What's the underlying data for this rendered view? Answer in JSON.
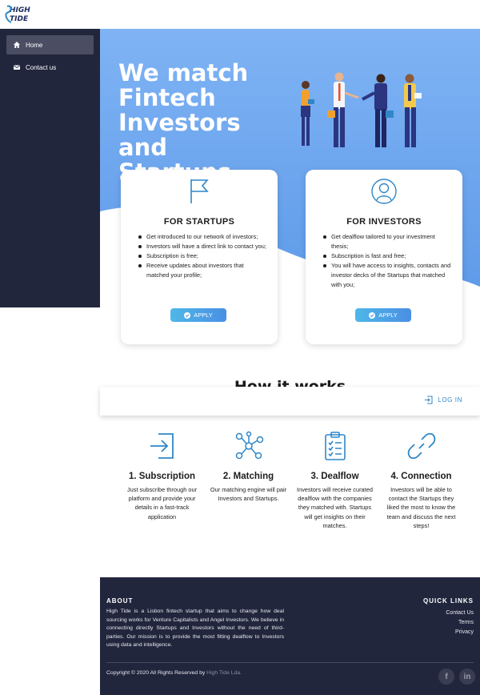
{
  "brand": {
    "logo_line1": "HIGH",
    "logo_line2": "TIDE"
  },
  "sidebar": {
    "items": [
      {
        "label": "Home",
        "icon": "home-icon",
        "active": true
      },
      {
        "label": "Contact us",
        "icon": "mail-icon",
        "active": false
      }
    ]
  },
  "hero": {
    "title": "We match Fintech Investors and Startups"
  },
  "cards": [
    {
      "title": "FOR STARTUPS",
      "icon": "flag-icon",
      "bullets": [
        "Get introduced to our network of investors;",
        "Investors will have a direct link to contact you;",
        "Subscription is free;",
        "Receive updates about investors that matched your profile;"
      ],
      "button": "APPLY"
    },
    {
      "title": "FOR INVESTORS",
      "icon": "user-icon",
      "bullets": [
        "Get dealflow tailored to your investment thesis;",
        "Subscription is fast and free;",
        "You will have access to insights, contacts and investor decks of the Startups that matched with you;"
      ],
      "button": "APPLY"
    }
  ],
  "how": {
    "title": "How it works"
  },
  "login": {
    "label": "LOG IN"
  },
  "steps": [
    {
      "title": "1. Subscription",
      "desc": "Just subscribe through our platform and provide your details in a fast-track application",
      "icon": "sign-in-icon"
    },
    {
      "title": "2. Matching",
      "desc": "Our matching engine will pair Investors and Startups.",
      "icon": "network-icon"
    },
    {
      "title": "3. Dealflow",
      "desc": "Investors will receive curated dealflow with the companies they matched with. Startups will get insights on their matches.",
      "icon": "clipboard-icon"
    },
    {
      "title": "4. Connection",
      "desc": "Investors will be able to contact the Startups they liked the most to know the team and discuss the next steps!",
      "icon": "link-icon"
    }
  ],
  "footer": {
    "about_heading": "ABOUT",
    "about_text": "High Tide is a Lisbon fintech startup that aims to change how deal sourcing works for Venture Capitalists and Angel Investors. We believe in connecting directly Startups and Investors without the need of third-parties. Our mission is to provide the most fitting dealflow to Investors using data and intelligence.",
    "links_heading": "QUICK LINKS",
    "links": [
      "Contact Us",
      "Terms",
      "Privacy"
    ],
    "copyright": "Copyright © 2020 All Rights Reserved by ",
    "copyright_brand": "High Tide Lda.",
    "social": [
      "f",
      "in"
    ]
  },
  "colors": {
    "sidebar_bg": "#22263d",
    "hero_blue": "#6fa7ee",
    "accent_blue": "#2f87c8",
    "button_gradient_start": "#4fb7e8",
    "button_gradient_end": "#4a8fe4"
  }
}
